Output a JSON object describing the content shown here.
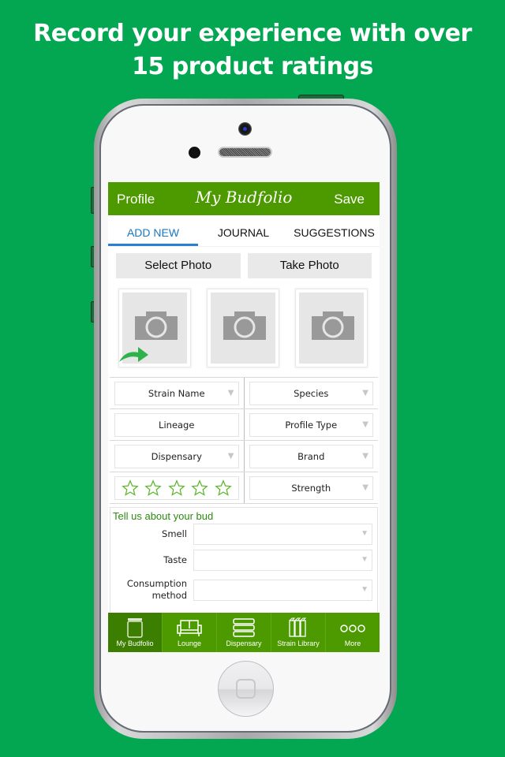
{
  "headline": {
    "line1": "Record your experience with over",
    "line2": "15 product ratings"
  },
  "navbar": {
    "left_label": "Profile",
    "title": "My Budfolio",
    "right_label": "Save"
  },
  "tabs": [
    {
      "label": "ADD NEW",
      "active": true
    },
    {
      "label": "JOURNAL",
      "active": false
    },
    {
      "label": "SUGGESTIONS",
      "active": false
    }
  ],
  "photo_buttons": {
    "select": "Select Photo",
    "take": "Take Photo"
  },
  "photo_slots": [
    {
      "icon": "camera-icon",
      "has_arrow": true
    },
    {
      "icon": "camera-icon",
      "has_arrow": false
    },
    {
      "icon": "camera-icon",
      "has_arrow": false
    }
  ],
  "fields": {
    "strain_name": "Strain Name",
    "species": "Species",
    "lineage": "Lineage",
    "profile_type": "Profile Type",
    "dispensary": "Dispensary",
    "brand": "Brand",
    "rating": {
      "value": 0,
      "max": 5
    },
    "strength": "Strength"
  },
  "about": {
    "title": "Tell us about your bud",
    "rows": [
      {
        "label": "Smell",
        "value": ""
      },
      {
        "label": "Taste",
        "value": ""
      },
      {
        "label": "Consumption method",
        "value": ""
      }
    ]
  },
  "tabbar": [
    {
      "label": "My Budfolio",
      "icon": "jar-icon",
      "active": true
    },
    {
      "label": "Lounge",
      "icon": "couch-icon",
      "active": false
    },
    {
      "label": "Dispensary",
      "icon": "stack-icon",
      "active": false
    },
    {
      "label": "Strain Library",
      "icon": "books-icon",
      "active": false
    },
    {
      "label": "More",
      "icon": "more-dots-icon",
      "active": false
    }
  ],
  "colors": {
    "background": "#03a651",
    "nav_green": "#4d9a00",
    "active_tab_blue": "#1a78c2",
    "star_green": "#5fb832"
  }
}
